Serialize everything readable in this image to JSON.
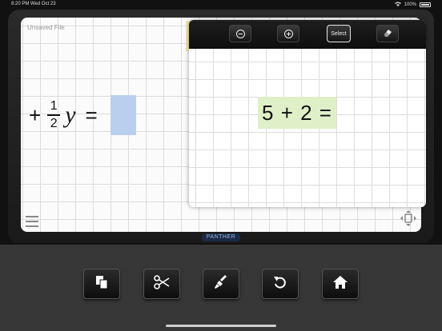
{
  "status_bar": {
    "time": "8:20 PM",
    "date": "Wed Oct 23",
    "battery": "100%"
  },
  "document": {
    "file_label": "Unsaved File"
  },
  "main_expression": {
    "plus": "+",
    "fraction_numerator": "1",
    "fraction_denominator": "2",
    "variable": "y",
    "equals": "="
  },
  "panel": {
    "toolbar": {
      "select_label": "Select"
    },
    "expression": "5 + 2 ="
  },
  "brand": "PANTHER",
  "colors": {
    "answer_slot": "#b9cff0",
    "panel_expression_bg": "#dff0c8",
    "brand_bg": "#1c2a44"
  },
  "icons": {
    "zoom_out": "minus-circle-icon",
    "zoom_in": "plus-circle-icon",
    "eraser": "eraser-icon",
    "menu": "hamburger-icon",
    "resize": "move-resize-icon",
    "copy": "copy-icon",
    "cut": "scissors-icon",
    "brush": "paintbrush-icon",
    "undo": "undo-icon",
    "home": "home-icon"
  }
}
